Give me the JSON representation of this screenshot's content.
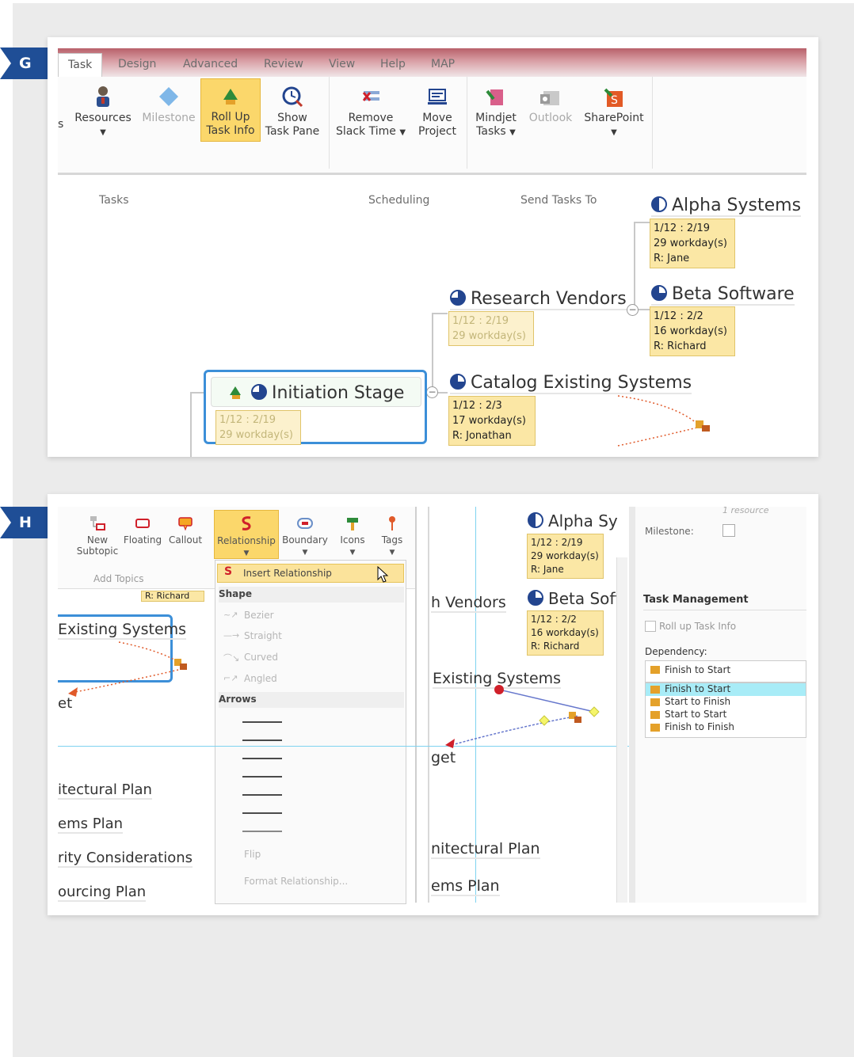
{
  "panel_g": {
    "label": "G",
    "tabs": [
      "Task",
      "Design",
      "Advanced",
      "Review",
      "View",
      "Help",
      "MAP"
    ],
    "cut_label": "s",
    "buttons": {
      "resources": "Resources",
      "milestone": "Milestone",
      "rollup_l1": "Roll Up",
      "rollup_l2": "Task Info",
      "show_l1": "Show",
      "show_l2": "Task Pane",
      "remove_l1": "Remove",
      "remove_l2": "Slack Time",
      "move_l1": "Move",
      "move_l2": "Project",
      "mindjet_l1": "Mindjet",
      "mindjet_l2": "Tasks",
      "outlook": "Outlook",
      "sharepoint": "SharePoint"
    },
    "groups": {
      "tasks": "Tasks",
      "scheduling": "Scheduling",
      "send": "Send Tasks To"
    },
    "nodes": {
      "alpha": {
        "title": "Alpha Systems",
        "dates": "1/12 : 2/19",
        "work": "29 workday(s)",
        "res": "R: Jane"
      },
      "beta": {
        "title": "Beta Software",
        "dates": "1/12 : 2/2",
        "work": "16 workday(s)",
        "res": "R: Richard"
      },
      "research": {
        "title": "Research Vendors",
        "dates": "1/12 : 2/19",
        "work": "29 workday(s)"
      },
      "catalog": {
        "title": "Catalog Existing Systems",
        "dates": "1/12 : 2/3",
        "work": "17 workday(s)",
        "res": "R: Jonathan"
      },
      "initiation": {
        "title": "Initiation Stage",
        "dates": "1/12 : 2/19",
        "work": "29 workday(s)"
      }
    }
  },
  "panel_h": {
    "label": "H",
    "toolbar": {
      "new_subtopic_l1": "New",
      "new_subtopic_l2": "Subtopic",
      "floating": "Floating",
      "callout": "Callout",
      "relationship": "Relationship",
      "boundary": "Boundary",
      "icons": "Icons",
      "tags": "Tags",
      "add_topics": "Add Topics"
    },
    "menu": {
      "insert": "Insert Relationship",
      "shape_header": "Shape",
      "shapes": [
        "Bezier",
        "Straight",
        "Curved",
        "Angled"
      ],
      "arrows_header": "Arrows",
      "flip": "Flip",
      "format": "Format Relationship..."
    },
    "left_map": {
      "richard": "R: Richard",
      "existing": "Existing Systems",
      "et": "et",
      "architectural": "itectural Plan",
      "ems": "ems Plan",
      "rity": "rity Considerations",
      "ourcing": "ourcing Plan"
    },
    "mid_map": {
      "alpha": {
        "title": "Alpha Sy",
        "dates": "1/12 : 2/19",
        "work": "29 workday(s)",
        "res": "R: Jane"
      },
      "beta": {
        "title": "Beta Soft",
        "dates": "1/12 : 2/2",
        "work": "16 workday(s)",
        "res": "R: Richard"
      },
      "vendors": "h Vendors",
      "existing": "Existing Systems",
      "get": "get",
      "architectural": "nitectural Plan",
      "ems": "ems Plan"
    },
    "pane": {
      "resource_cut": "1 resource",
      "milestone": "Milestone:",
      "section": "Task Management",
      "rollup": "Roll up Task Info",
      "dependency_label": "Dependency:",
      "dependency_options": [
        "Finish to Start",
        "Finish to Start",
        "Start to Finish",
        "Start to Start",
        "Finish to Finish"
      ],
      "selected_index": 1
    }
  },
  "colors": {
    "label_blue": "#1f4e96",
    "task_info": "#fbe7a5",
    "selection": "#fbd76b",
    "guide": "#7fd3f0"
  }
}
